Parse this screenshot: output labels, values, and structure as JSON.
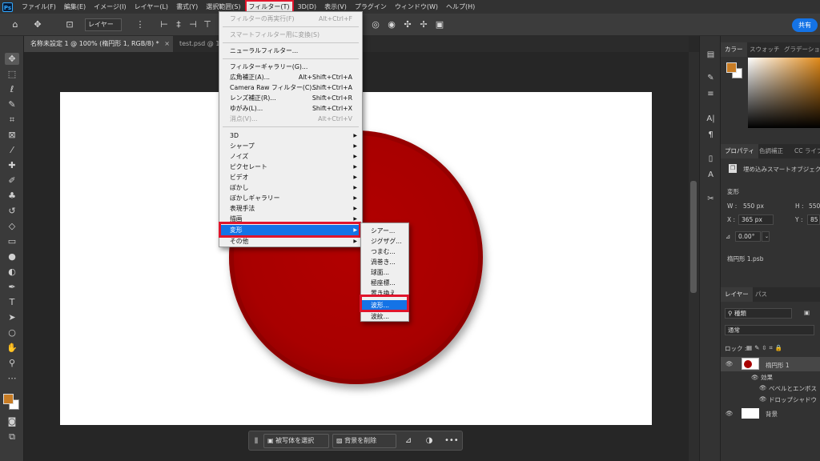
{
  "app": {
    "logo": "Ps"
  },
  "menubar": {
    "items": [
      "ファイル(F)",
      "編集(E)",
      "イメージ(I)",
      "レイヤー(L)",
      "書式(Y)",
      "選択範囲(S)",
      "フィルター(T)",
      "3D(D)",
      "表示(V)",
      "プラグイン",
      "ウィンドウ(W)",
      "ヘルプ(H)"
    ],
    "active_index": 6
  },
  "options_bar": {
    "layer_select": "レイヤー",
    "share_label": "共有"
  },
  "tabs": {
    "active": "名称未設定 1 @ 100% (楕円形 1, RGB/8) *",
    "close": "×",
    "second": "test.psd @ 10"
  },
  "filter_menu": {
    "items": [
      {
        "label": "フィルターの再実行(F)",
        "shortcut": "Alt+Ctrl+F",
        "disabled": true
      },
      {
        "label": "スマートフィルター用に変換(S)",
        "disabled": true
      },
      {
        "label": "ニューラルフィルター..."
      },
      {
        "label": "フィルターギャラリー(G)..."
      },
      {
        "label": "広角補正(A)...",
        "shortcut": "Alt+Shift+Ctrl+A"
      },
      {
        "label": "Camera Raw フィルター(C)...",
        "shortcut": "Shift+Ctrl+A"
      },
      {
        "label": "レンズ補正(R)...",
        "shortcut": "Shift+Ctrl+R"
      },
      {
        "label": "ゆがみ(L)...",
        "shortcut": "Shift+Ctrl+X"
      },
      {
        "label": "消点(V)...",
        "shortcut": "Alt+Ctrl+V",
        "disabled": true
      },
      {
        "label": "3D",
        "submenu": true
      },
      {
        "label": "シャープ",
        "submenu": true
      },
      {
        "label": "ノイズ",
        "submenu": true
      },
      {
        "label": "ピクセレート",
        "submenu": true
      },
      {
        "label": "ビデオ",
        "submenu": true
      },
      {
        "label": "ぼかし",
        "submenu": true
      },
      {
        "label": "ぼかしギャラリー",
        "submenu": true
      },
      {
        "label": "表現手法",
        "submenu": true
      },
      {
        "label": "描画",
        "submenu": true
      },
      {
        "label": "変形",
        "submenu": true,
        "highlighted": true
      },
      {
        "label": "その他",
        "submenu": true
      }
    ]
  },
  "distort_submenu": {
    "items": [
      "シアー...",
      "ジグザグ...",
      "つまむ...",
      "渦巻き...",
      "球面...",
      "極座標...",
      "置き換え...",
      "波形...",
      "波紋..."
    ],
    "highlighted_index": 7
  },
  "taskbar": {
    "select_subject": "被写体を選択",
    "remove_bg": "背景を削除",
    "more": "•••"
  },
  "color_panel": {
    "tabs": [
      "カラー",
      "スウォッチ",
      "グラデーション"
    ],
    "fg_color": "#c87c24",
    "bg_color": "#ffffff"
  },
  "properties_panel": {
    "tabs": [
      "プロパティ",
      "色調補正",
      "CC ライブ"
    ],
    "object_type": "埋め込みスマートオブジェクト",
    "section": "変形",
    "w_label": "W :",
    "w_value": "550 px",
    "h_label": "H :",
    "h_value": "550",
    "x_label": "X :",
    "x_value": "365 px",
    "y_label": "Y :",
    "y_value": "85 p",
    "angle": "0.00°",
    "filename": "楕円形 1.psb"
  },
  "layers_panel": {
    "tabs": [
      "レイヤー",
      "パス"
    ],
    "filter_kind": "種類",
    "blend_mode": "通常",
    "lock_label": "ロック :",
    "layers": [
      {
        "name": "楕円形 1",
        "effects_label": "効果",
        "effects": [
          "ベベルとエンボス",
          "ドロップシャドウ"
        ]
      },
      {
        "name": "背景"
      }
    ]
  },
  "colors": {
    "accent": "#1473e6",
    "highlight_frame": "#e0152c",
    "circle": "#a80000"
  }
}
